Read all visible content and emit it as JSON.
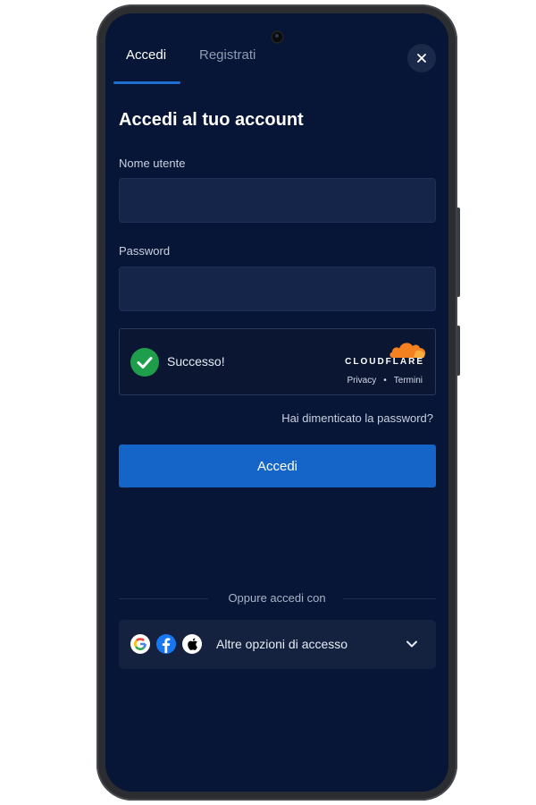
{
  "tabs": [
    {
      "label": "Accedi",
      "active": true
    },
    {
      "label": "Registrati",
      "active": false
    }
  ],
  "close_icon": "close-icon",
  "heading": "Accedi al tuo account",
  "form": {
    "username_label": "Nome utente",
    "username_value": "",
    "password_label": "Password",
    "password_value": ""
  },
  "captcha": {
    "status": "Successo!",
    "provider": "CLOUDFLARE",
    "privacy_link": "Privacy",
    "separator": "•",
    "terms_link": "Termini",
    "success_color": "#1e9e4a",
    "brand_color": "#f48120"
  },
  "forgot_password": "Hai dimenticato la password?",
  "login_button": "Accedi",
  "divider_text": "Oppure accedi con",
  "social": {
    "label": "Altre opzioni di accesso",
    "icons": [
      "google-icon",
      "facebook-icon",
      "apple-icon"
    ]
  },
  "colors": {
    "background": "#071637",
    "accent": "#1565c8",
    "input": "#15254a"
  }
}
